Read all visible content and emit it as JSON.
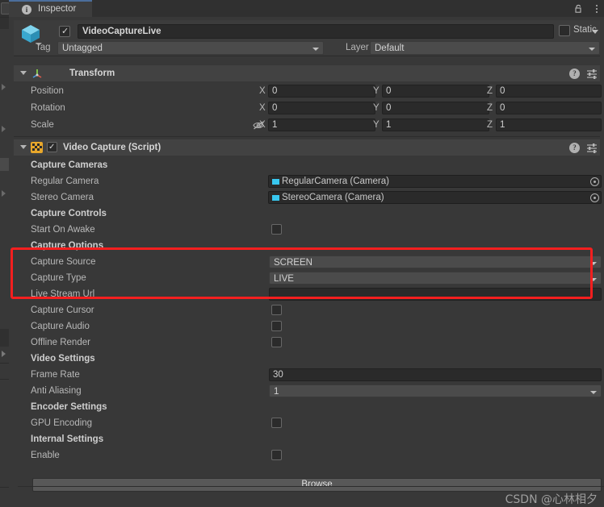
{
  "window": {
    "tab_label": "Inspector",
    "tab_icon": "info-icon",
    "lock_icon": "lock-open-icon",
    "menu_icon": "kebab-menu-icon"
  },
  "object_header": {
    "enabled": true,
    "name": "VideoCaptureLive",
    "static_label": "Static",
    "static_checked": false,
    "tag_label": "Tag",
    "tag_value": "Untagged",
    "layer_label": "Layer",
    "layer_value": "Default",
    "icon": "cube-icon"
  },
  "transform": {
    "title": "Transform",
    "icon": "transform-axis-icon",
    "axes": [
      "X",
      "Y",
      "Z"
    ],
    "rows": [
      {
        "label": "Position",
        "values": [
          "0",
          "0",
          "0"
        ],
        "hidden_icon": false
      },
      {
        "label": "Rotation",
        "values": [
          "0",
          "0",
          "0"
        ],
        "hidden_icon": false
      },
      {
        "label": "Scale",
        "values": [
          "1",
          "1",
          "1"
        ],
        "hidden_icon": true
      }
    ]
  },
  "video_capture": {
    "title": "Video Capture (Script)",
    "enabled": true,
    "icon": "script-icon",
    "sections": [
      {
        "kind": "header",
        "label": "Capture Cameras"
      },
      {
        "kind": "object",
        "label": "Regular Camera",
        "value": "RegularCamera (Camera)",
        "icon": "camera-icon"
      },
      {
        "kind": "object",
        "label": "Stereo Camera",
        "value": "StereoCamera (Camera)",
        "icon": "camera-icon"
      },
      {
        "kind": "header",
        "label": "Capture Controls"
      },
      {
        "kind": "checkbox",
        "label": "Start On Awake",
        "checked": false
      },
      {
        "kind": "header",
        "label": "Capture Options"
      },
      {
        "kind": "dropdown",
        "label": "Capture Source",
        "value": "SCREEN"
      },
      {
        "kind": "dropdown",
        "label": "Capture Type",
        "value": "LIVE"
      },
      {
        "kind": "text",
        "label": "Live Stream Url",
        "value": ""
      },
      {
        "kind": "checkbox",
        "label": "Capture Cursor",
        "checked": false
      },
      {
        "kind": "checkbox",
        "label": "Capture Audio",
        "checked": false
      },
      {
        "kind": "checkbox",
        "label": "Offline Render",
        "checked": false
      },
      {
        "kind": "header",
        "label": "Video Settings"
      },
      {
        "kind": "text",
        "label": "Frame Rate",
        "value": "30"
      },
      {
        "kind": "dropdown",
        "label": "Anti Aliasing",
        "value": "1"
      },
      {
        "kind": "header",
        "label": "Encoder Settings"
      },
      {
        "kind": "checkbox",
        "label": "GPU Encoding",
        "checked": false
      },
      {
        "kind": "header",
        "label": "Internal Settings"
      },
      {
        "kind": "checkbox",
        "label": "Enable",
        "checked": false
      }
    ],
    "browse_label": "Browse"
  },
  "highlight": {
    "color": "#f51f1f"
  },
  "watermark": {
    "text": "CSDN @心林相夕"
  }
}
